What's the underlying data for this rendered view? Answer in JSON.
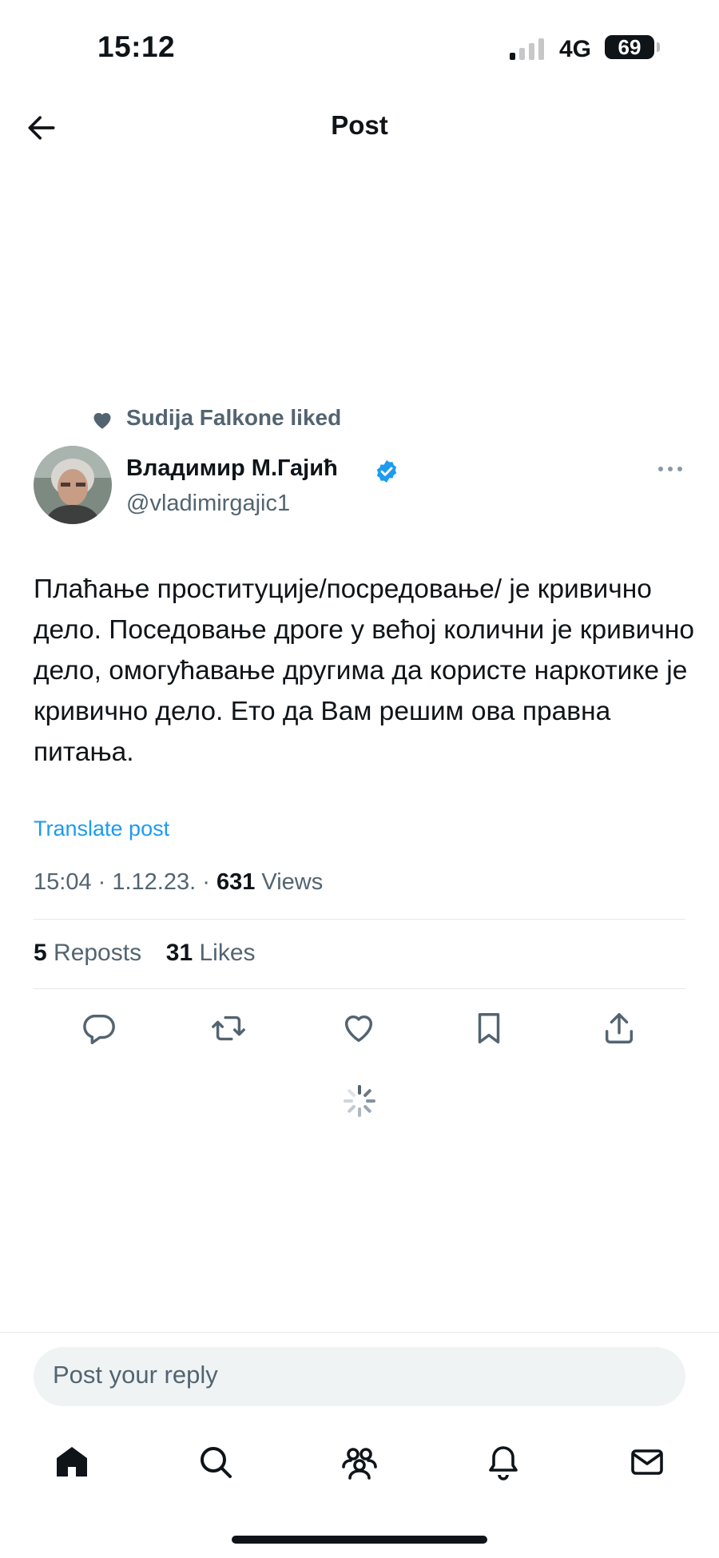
{
  "status_bar": {
    "time": "15:12",
    "network": "4G",
    "battery": "69"
  },
  "header": {
    "title": "Post"
  },
  "social_context": {
    "text": "Sudija Falkone liked"
  },
  "post": {
    "author_name": "Владимир М.Гајић",
    "handle": "@vladimirgajic1",
    "text": "Плаћање проституције/посредовање/ је кривично дело. Поседовање дроге у већој колични је кривично дело, омогућавање другима да користе наркотике је кривично дело. Ето да Вам решим ова правна питања.",
    "translate_label": "Translate post",
    "time_date": "15:04 · 1.12.23. · ",
    "views_count": "631",
    "views_label": " Views",
    "reposts_count": "5",
    "reposts_label": " Reposts",
    "likes_count": "31",
    "likes_label": " Likes"
  },
  "reply": {
    "placeholder": "Post your reply"
  },
  "icons": {
    "back": "arrow-left-icon",
    "verified": "verified-badge-icon",
    "more": "more-icon",
    "reply": "reply-icon",
    "repost": "repost-icon",
    "like": "heart-icon",
    "bookmark": "bookmark-icon",
    "share": "share-icon",
    "loading": "spinner-icon",
    "nav": [
      "home-icon",
      "search-icon",
      "communities-icon",
      "notifications-icon",
      "messages-icon"
    ]
  },
  "colors": {
    "accent": "#1d9bf0",
    "secondary_text": "#536471",
    "primary_text": "#0f1419"
  }
}
